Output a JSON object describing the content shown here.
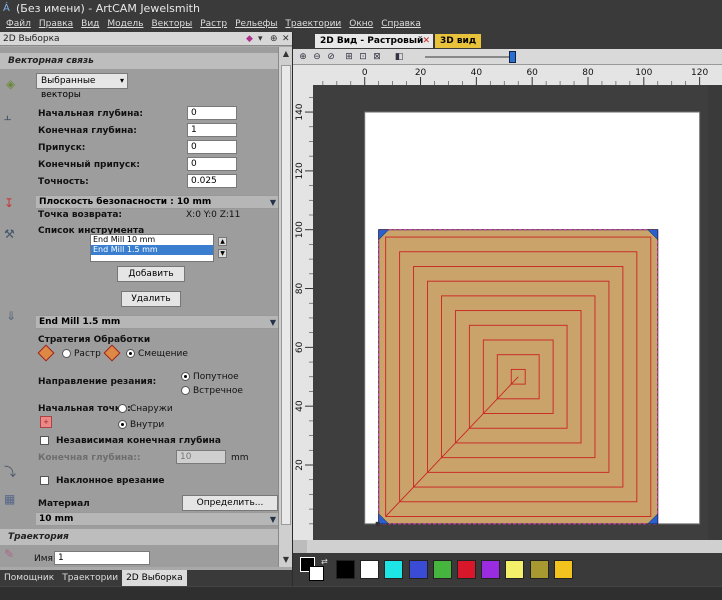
{
  "window": {
    "title": "(Без имени) - ArtCAM Jewelsmith"
  },
  "menu": [
    "Файл",
    "Правка",
    "Вид",
    "Модель",
    "Векторы",
    "Растр",
    "Рельефы",
    "Траектории",
    "Окно",
    "Справка"
  ],
  "panel": {
    "title": "2D Выборка",
    "vector_section": "Векторная связь",
    "vector_select": "Выбранные векторы",
    "params": [
      {
        "label": "Начальная глубина:",
        "value": "0"
      },
      {
        "label": "Конечная глубина:",
        "value": "1"
      },
      {
        "label": "Припуск:",
        "value": "0"
      },
      {
        "label": "Конечный припуск:",
        "value": "0"
      },
      {
        "label": "Точность:",
        "value": "0.025"
      }
    ],
    "safety_plane": "Плоскость безопасности : 10 mm",
    "return_point_label": "Точка возврата:",
    "return_point_value": "X:0 Y:0 Z:11",
    "tool_list_label": "Список инструмента",
    "tools": [
      "End Mill 10 mm",
      "End Mill 1.5 mm"
    ],
    "add_button": "Добавить",
    "delete_button": "Удалить",
    "selected_tool": "End Mill 1.5 mm",
    "strategy_label": "Стратегия Обработки",
    "strategy_raster": "Растр",
    "strategy_offset": "Смещение",
    "cut_dir_label": "Направление резания:",
    "cut_climb": "Попутное",
    "cut_conventional": "Встречное",
    "start_point_label": "Начальная точка:",
    "start_outside": "Снаружи",
    "start_inside": "Внутри",
    "independent_depth": "Независимая конечная глубина",
    "final_depth_label": "Конечная глубина::",
    "final_depth_value": "10",
    "final_depth_unit": "mm",
    "ramp_label": "Наклонное врезание",
    "material_label": "Материал",
    "define_button": "Определить...",
    "material_value": "10 mm",
    "toolpath_section": "Траектория",
    "name_label": "Имя:",
    "name_value": "1"
  },
  "bottom_tabs": [
    "Помощник",
    "Траектории",
    "2D Выборка"
  ],
  "doc_tabs": {
    "active": "2D Вид - Растровый слой",
    "other": "3D вид"
  },
  "chart_data": {
    "type": "line",
    "title": "",
    "x_ticks": [
      0,
      20,
      40,
      60,
      80,
      100,
      120
    ],
    "y_ticks": [
      140,
      120,
      100,
      80,
      60,
      40,
      20
    ],
    "xlim": [
      -25.7,
      123
    ],
    "ylim": [
      -5.5,
      156
    ],
    "grid": false,
    "work_area": {
      "x": [
        0,
        120
      ],
      "y": [
        0,
        140
      ]
    },
    "material_outline": {
      "x": [
        5,
        105
      ],
      "y": [
        0,
        100
      ]
    },
    "pocket_fill": "#c9a36a",
    "toolpath_color": "#cc2222",
    "toolpath_insets": [
      2.5,
      7.5,
      12.5,
      17.5,
      22.5,
      27.5,
      32.5,
      37.5,
      42.5,
      47.5
    ],
    "toolpath_link": {
      "from": [
        7.5,
        2.5
      ],
      "to": [
        55,
        50
      ]
    },
    "vector_outline_color": "#cc33cc"
  },
  "palette": [
    "#000000",
    "#ffffff",
    "#1ee5e5",
    "#3a4bd6",
    "#45b53d",
    "#d8172b",
    "#9b2be0",
    "#f4f06a",
    "#a7982f",
    "#f2c31e"
  ]
}
